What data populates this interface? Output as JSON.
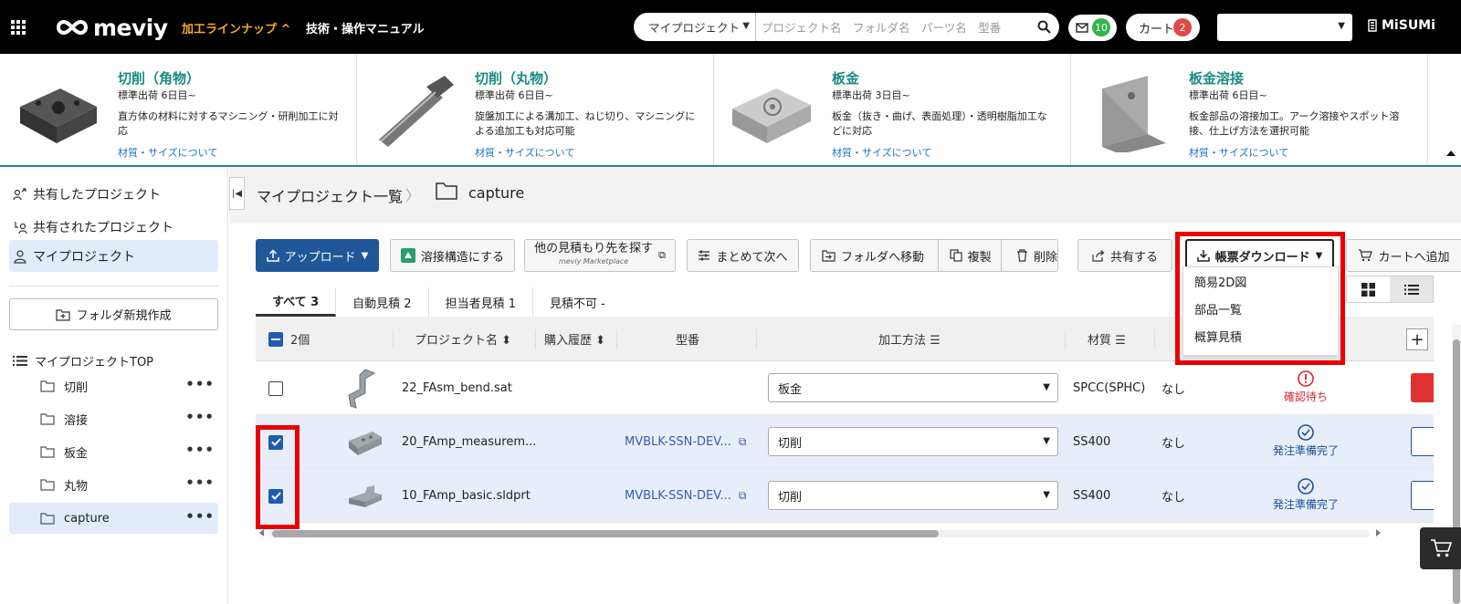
{
  "header": {
    "logo": "meviy",
    "nav_lineup": "加工ラインナップ ^",
    "nav_manual": "技術・操作マニュアル",
    "search_scope": "マイプロジェクト",
    "search_placeholder": "プロジェクト名　フォルダ名　パーツ名　型番",
    "mail_count": "10",
    "cart_label": "カート",
    "cart_count": "2",
    "brand": "MiSUMi"
  },
  "lineup": [
    {
      "title": "切削（角物）",
      "ship": "標準出荷 6日目~",
      "desc": "直方体の材料に対するマシニング・研削加工に対応",
      "link": "材質・サイズについて"
    },
    {
      "title": "切削（丸物）",
      "ship": "標準出荷 6日目~",
      "desc": "旋盤加工による溝加工、ねじ切り、マシニングによる追加工も対応可能",
      "link": "材質・サイズについて"
    },
    {
      "title": "板金",
      "ship": "標準出荷 3日目~",
      "desc": "板金（抜き・曲げ、表面処理）・透明樹脂加工などに対応",
      "link": "材質・サイズについて"
    },
    {
      "title": "板金溶接",
      "ship": "標準出荷 6日目~",
      "desc": "板金部品の溶接加工。アーク溶接やスポット溶接、仕上げ方法を選択可能",
      "link": "材質・サイズについて"
    }
  ],
  "sidebar": {
    "shared_by_me": "共有したプロジェクト",
    "shared_with_me": "共有されたプロジェクト",
    "my_projects": "マイプロジェクト",
    "new_folder": "フォルダ新規作成",
    "tree_root": "マイプロジェクトTOP",
    "folders": [
      "切削",
      "溶接",
      "板金",
      "丸物",
      "capture"
    ]
  },
  "breadcrumb": {
    "root": "マイプロジェクト一覧",
    "current": "capture"
  },
  "toolbar": {
    "upload": "アップロード",
    "weld": "溶接構造にする",
    "other_quote": "他の見積もり先を探す",
    "marketplace": "meviy Marketplace",
    "bulk_next": "まとめて次へ",
    "move_folder": "フォルダへ移動",
    "duplicate": "複製",
    "delete": "削除",
    "share": "共有する",
    "report_download": "帳票ダウンロード",
    "add_cart": "カートへ追加"
  },
  "dropdown": {
    "items": [
      "簡易2D図",
      "部品一覧",
      "概算見積"
    ]
  },
  "tabs": [
    {
      "label": "すべて 3"
    },
    {
      "label": "自動見積 2"
    },
    {
      "label": "担当者見積 1"
    },
    {
      "label": "見積不可 -"
    }
  ],
  "table": {
    "selected_count": "2個",
    "headers": {
      "project_name": "プロジェクト名 ⬍",
      "purchase_history": "購入履歴 ⬍",
      "part_number": "型番",
      "method": "加工方法 ☰",
      "material": "材質 ☰"
    },
    "rows": [
      {
        "name": "22_FAsm_bend.sat",
        "part": "",
        "method": "板金",
        "material": "SPCC(SPHC)",
        "treatment": "なし",
        "status": "確認待ち",
        "checked": false
      },
      {
        "name": "20_FAmp_measurem...",
        "part": "MVBLK-SSN-DEV...",
        "method": "切削",
        "material": "SS400",
        "treatment": "なし",
        "status": "発注準備完了",
        "checked": true
      },
      {
        "name": "10_FAmp_basic.sldprt",
        "part": "MVBLK-SSN-DEV...",
        "method": "切削",
        "material": "SS400",
        "treatment": "なし",
        "status": "発注準備完了",
        "checked": true
      }
    ]
  },
  "colors": {
    "header_bg": "#000000",
    "accent_teal": "#1b8a83",
    "primary_blue": "#1f5799",
    "highlight_red": "#ea0000",
    "selection_bg": "#e7eefa"
  }
}
